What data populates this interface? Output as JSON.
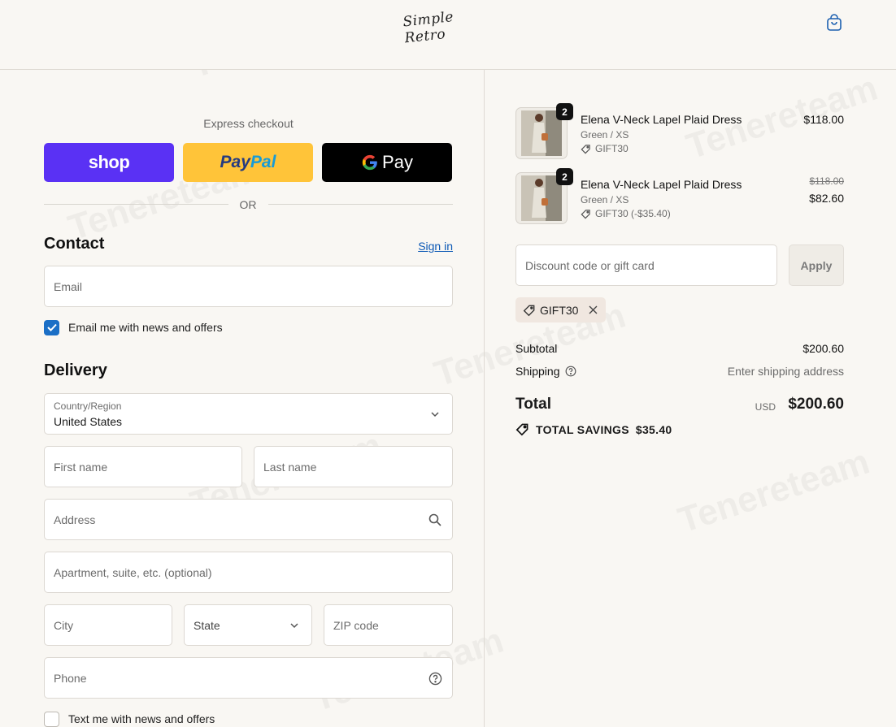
{
  "header": {
    "logo_text": "Simple Retro",
    "cart_icon": "shopping-bag-icon"
  },
  "express": {
    "title": "Express checkout",
    "shop_label": "shop",
    "paypal_part1": "Pay",
    "paypal_part2": "Pal",
    "gpay_label": "Pay",
    "or_label": "OR"
  },
  "contact": {
    "title": "Contact",
    "signin_label": "Sign in",
    "email_placeholder": "Email",
    "news_label": "Email me with news and offers",
    "news_checked": true
  },
  "delivery": {
    "title": "Delivery",
    "country_label": "Country/Region",
    "country_value": "United States",
    "first_name_placeholder": "First name",
    "last_name_placeholder": "Last name",
    "address_placeholder": "Address",
    "apartment_placeholder": "Apartment, suite, etc. (optional)",
    "city_placeholder": "City",
    "state_placeholder": "State",
    "zip_placeholder": "ZIP code",
    "phone_placeholder": "Phone",
    "text_news_label": "Text me with news and offers",
    "text_news_checked": false
  },
  "cart": {
    "items": [
      {
        "quantity": "2",
        "name": "Elena V-Neck Lapel Plaid Dress",
        "variant": "Green / XS",
        "discount": "GIFT30",
        "price": "$118.00"
      },
      {
        "quantity": "2",
        "name": "Elena V-Neck Lapel Plaid Dress",
        "variant": "Green / XS",
        "discount": "GIFT30 (-$35.40)",
        "original_price": "$118.00",
        "price": "$82.60"
      }
    ]
  },
  "discount": {
    "placeholder": "Discount code or gift card",
    "apply_label": "Apply",
    "applied_code": "GIFT30"
  },
  "summary": {
    "subtotal_label": "Subtotal",
    "subtotal_value": "$200.60",
    "shipping_label": "Shipping",
    "shipping_value": "Enter shipping address",
    "total_label": "Total",
    "total_currency": "USD",
    "total_value": "$200.60",
    "savings_label": "TOTAL SAVINGS",
    "savings_value": "$35.40"
  },
  "watermark": {
    "text": "Tenereteam"
  },
  "colors": {
    "shop_purple": "#5a31f4",
    "paypal_yellow": "#ffc439",
    "link_blue": "#0b58b5",
    "checkbox_blue": "#1b6fc6"
  }
}
